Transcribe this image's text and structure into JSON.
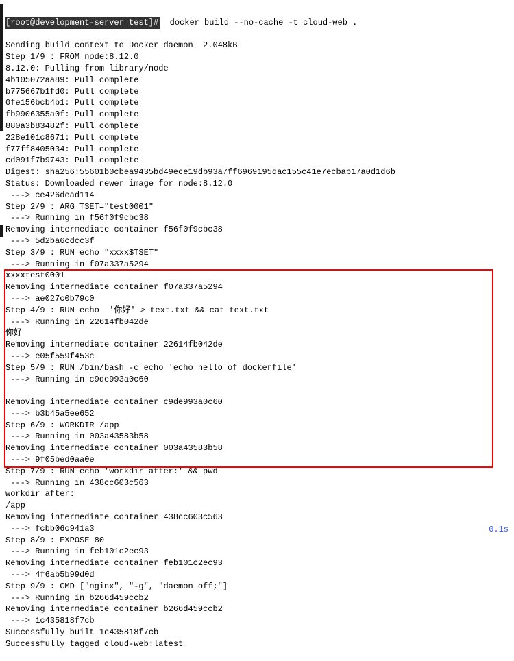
{
  "prompt": "[root@development-server test]#",
  "command": "  docker build --no-cache -t cloud-web .",
  "lines": [
    "Sending build context to Docker daemon  2.048kB",
    "Step 1/9 : FROM node:8.12.0",
    "8.12.0: Pulling from library/node",
    "4b105072aa89: Pull complete",
    "b775667b1fd0: Pull complete",
    "0fe156bcb4b1: Pull complete",
    "fb9906355a0f: Pull complete",
    "880a3b83482f: Pull complete",
    "228e101c8671: Pull complete",
    "f77ff8405034: Pull complete",
    "cd091f7b9743: Pull complete",
    "Digest: sha256:55601b0cbea9435bd49ece19db93a7ff6969195dac155c41e7ecbab17a0d1d6b",
    "Status: Downloaded newer image for node:8.12.0",
    " ---> ce426dead114",
    "Step 2/9 : ARG TSET=\"test0001\"",
    " ---> Running in f56f0f9cbc38",
    "Removing intermediate container f56f0f9cbc38",
    " ---> 5d2ba6cdcc3f",
    "Step 3/9 : RUN echo \"xxxx$TSET\"",
    " ---> Running in f07a337a5294",
    "xxxxtest0001",
    "Removing intermediate container f07a337a5294",
    " ---> ae027c0b79c0",
    "Step 4/9 : RUN echo  '你好' > text.txt && cat text.txt",
    " ---> Running in 22614fb042de",
    "你好",
    "Removing intermediate container 22614fb042de",
    " ---> e05f559f453c",
    "Step 5/9 : RUN /bin/bash -c echo 'echo hello of dockerfile'",
    " ---> Running in c9de993a0c60",
    "",
    "Removing intermediate container c9de993a0c60",
    " ---> b3b45a5ee652",
    "Step 6/9 : WORKDIR /app",
    " ---> Running in 003a43583b58",
    "Removing intermediate container 003a43583b58",
    " ---> 9f05bed0aa0e",
    "Step 7/9 : RUN echo 'workdir after:' && pwd",
    " ---> Running in 438cc603c563",
    "workdir after:",
    "/app",
    "Removing intermediate container 438cc603c563",
    " ---> fcbb06c941a3",
    "Step 8/9 : EXPOSE 80",
    " ---> Running in feb101c2ec93",
    "Removing intermediate container feb101c2ec93",
    " ---> 4f6ab5b99d0d",
    "Step 9/9 : CMD [\"nginx\", \"-g\", \"daemon off;\"]",
    " ---> Running in b266d459ccb2",
    "Removing intermediate container b266d459ccb2",
    " ---> 1c435818f7cb",
    "Successfully built 1c435818f7cb",
    "Successfully tagged cloud-web:latest"
  ],
  "timing": "0.1s"
}
